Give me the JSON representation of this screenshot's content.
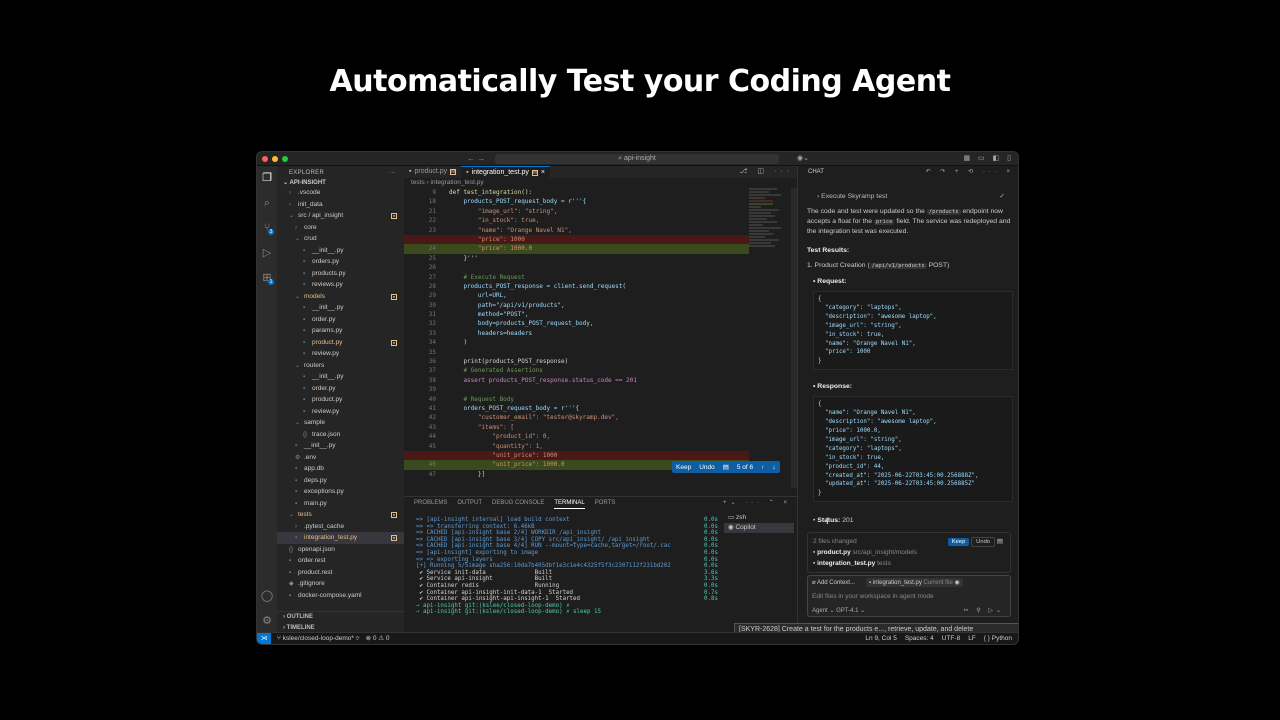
{
  "headline": "Automatically Test your Coding Agent",
  "window": {
    "search": "api-insight",
    "dots": [
      "#ff5f57",
      "#febc2e",
      "#28c840"
    ]
  },
  "explorer": {
    "title": "EXPLORER",
    "root": "API-INSIGHT",
    "items": [
      {
        "label": ".vscode",
        "indent": 12,
        "icon": "›"
      },
      {
        "label": "init_data",
        "indent": 12,
        "icon": "›"
      },
      {
        "label": "src / api_insight",
        "indent": 12,
        "icon": "⌄",
        "mod": true
      },
      {
        "label": "core",
        "indent": 18,
        "icon": "›"
      },
      {
        "label": "crud",
        "indent": 18,
        "icon": "⌄"
      },
      {
        "label": "__init__.py",
        "indent": 26,
        "icon": "▪",
        "py": true
      },
      {
        "label": "orders.py",
        "indent": 26,
        "icon": "▪",
        "py": true
      },
      {
        "label": "products.py",
        "indent": 26,
        "icon": "▪",
        "py": true
      },
      {
        "label": "reviews.py",
        "indent": 26,
        "icon": "▪",
        "py": true
      },
      {
        "label": "models",
        "indent": 18,
        "icon": "⌄",
        "mod": true,
        "y": true
      },
      {
        "label": "__init__.py",
        "indent": 26,
        "icon": "▪",
        "py": true
      },
      {
        "label": "order.py",
        "indent": 26,
        "icon": "▪",
        "py": true
      },
      {
        "label": "params.py",
        "indent": 26,
        "icon": "▪",
        "py": true
      },
      {
        "label": "product.py",
        "indent": 26,
        "icon": "▪",
        "py": true,
        "mod": true,
        "y": true
      },
      {
        "label": "review.py",
        "indent": 26,
        "icon": "▪",
        "py": true
      },
      {
        "label": "routers",
        "indent": 18,
        "icon": "⌄"
      },
      {
        "label": "__init__.py",
        "indent": 26,
        "icon": "▪",
        "py": true
      },
      {
        "label": "order.py",
        "indent": 26,
        "icon": "▪",
        "py": true
      },
      {
        "label": "product.py",
        "indent": 26,
        "icon": "▪",
        "py": true
      },
      {
        "label": "review.py",
        "indent": 26,
        "icon": "▪",
        "py": true
      },
      {
        "label": "sample",
        "indent": 18,
        "icon": "⌄"
      },
      {
        "label": "trace.json",
        "indent": 26,
        "icon": "{}"
      },
      {
        "label": "__init__.py",
        "indent": 18,
        "icon": "▪",
        "py": true
      },
      {
        "label": ".env",
        "indent": 18,
        "icon": "⚙"
      },
      {
        "label": "app.db",
        "indent": 18,
        "icon": "▪"
      },
      {
        "label": "deps.py",
        "indent": 18,
        "icon": "▪",
        "py": true
      },
      {
        "label": "exceptions.py",
        "indent": 18,
        "icon": "▪",
        "py": true
      },
      {
        "label": "main.py",
        "indent": 18,
        "icon": "▪",
        "py": true
      },
      {
        "label": "tests",
        "indent": 12,
        "icon": "⌄",
        "mod": true,
        "y": true
      },
      {
        "label": ".pytest_cache",
        "indent": 18,
        "icon": "›"
      },
      {
        "label": "integration_test.py",
        "indent": 18,
        "icon": "▪",
        "py": true,
        "mod": true,
        "sel": true,
        "y": true
      },
      {
        "label": "openapi.json",
        "indent": 12,
        "icon": "{}"
      },
      {
        "label": "order.rest",
        "indent": 12,
        "icon": "▪"
      },
      {
        "label": "product.rest",
        "indent": 12,
        "icon": "▪"
      },
      {
        "label": ".gitignore",
        "indent": 12,
        "icon": "◆"
      },
      {
        "label": "docker-compose.yaml",
        "indent": 12,
        "icon": "▪"
      }
    ],
    "outline": "OUTLINE",
    "timeline": "TIMELINE"
  },
  "editor": {
    "tabs": [
      {
        "label": "product.py",
        "active": false
      },
      {
        "label": "integration_test.py",
        "active": true
      }
    ],
    "breadcrumb": "tests  ›  integration_test.py",
    "keepbar": {
      "keep": "Keep",
      "undo": "Undo",
      "count": "5 of 6"
    },
    "lines": [
      {
        "n": "9",
        "cls": "",
        "t": "def test_integration():"
      },
      {
        "n": "18",
        "cls": "",
        "t": "    products_POST_request_body = r'''{"
      },
      {
        "n": "21",
        "cls": "",
        "t": "        \"image_url\": \"string\","
      },
      {
        "n": "22",
        "cls": "",
        "t": "        \"in_stock\": true,"
      },
      {
        "n": "23",
        "cls": "",
        "t": "        \"name\": \"Orange Navel N1\","
      },
      {
        "n": "",
        "cls": "del",
        "t": "        \"price\": 1000"
      },
      {
        "n": "24",
        "cls": "add",
        "t": "        \"price\": 1000.0"
      },
      {
        "n": "25",
        "cls": "",
        "t": "    }'''"
      },
      {
        "n": "26",
        "cls": "",
        "t": ""
      },
      {
        "n": "27",
        "cls": "",
        "t": "    # Execute Request"
      },
      {
        "n": "28",
        "cls": "",
        "t": "    products_POST_response = client.send_request("
      },
      {
        "n": "29",
        "cls": "",
        "t": "        url=URL,"
      },
      {
        "n": "30",
        "cls": "",
        "t": "        path=\"/api/v1/products\","
      },
      {
        "n": "31",
        "cls": "",
        "t": "        method=\"POST\","
      },
      {
        "n": "32",
        "cls": "",
        "t": "        body=products_POST_request_body,"
      },
      {
        "n": "33",
        "cls": "",
        "t": "        headers=headers"
      },
      {
        "n": "34",
        "cls": "",
        "t": "    )"
      },
      {
        "n": "35",
        "cls": "",
        "t": ""
      },
      {
        "n": "36",
        "cls": "",
        "t": "    print(products_POST_response)"
      },
      {
        "n": "37",
        "cls": "",
        "t": "    # Generated Assertions"
      },
      {
        "n": "38",
        "cls": "",
        "t": "    assert products_POST_response.status_code == 201"
      },
      {
        "n": "39",
        "cls": "",
        "t": ""
      },
      {
        "n": "40",
        "cls": "",
        "t": "    # Request Body"
      },
      {
        "n": "41",
        "cls": "",
        "t": "    orders_POST_request_body = r'''{"
      },
      {
        "n": "42",
        "cls": "",
        "t": "        \"customer_email\": \"tester@skyramp.dev\","
      },
      {
        "n": "43",
        "cls": "",
        "t": "        \"items\": ["
      },
      {
        "n": "44",
        "cls": "",
        "t": "            \"product_id\": 0,"
      },
      {
        "n": "45",
        "cls": "",
        "t": "            \"quantity\": 1,"
      },
      {
        "n": "",
        "cls": "del",
        "t": "            \"unit_price\": 1000"
      },
      {
        "n": "46",
        "cls": "add",
        "t": "            \"unit_price\": 1000.0"
      },
      {
        "n": "47",
        "cls": "",
        "t": "        }]"
      }
    ]
  },
  "panel": {
    "tabs": [
      "PROBLEMS",
      "OUTPUT",
      "DEBUG CONSOLE",
      "TERMINAL",
      "PORTS"
    ],
    "active": "TERMINAL",
    "terminals": [
      "zsh",
      "Copilot"
    ],
    "lines": [
      {
        "a": "=> [api-insight internal] load build context",
        "b": "0.0s",
        "cls": "a"
      },
      {
        "a": "=> => transferring context: 6.46kB",
        "b": "0.0s",
        "cls": "a"
      },
      {
        "a": "=> CACHED [api-insight base 2/4] WORKDIR /api_insight",
        "b": "0.0s",
        "cls": "a"
      },
      {
        "a": "=> CACHED [api-insight base 3/4] COPY src/api_insight/ /api_insight",
        "b": "0.0s",
        "cls": "a"
      },
      {
        "a": "=> CACHED [api-insight base 4/4] RUN --mount=type=cache,target=/root/.cac",
        "b": "0.0s",
        "cls": "a"
      },
      {
        "a": "=> [api-insight] exporting to image",
        "b": "0.0s",
        "cls": "a"
      },
      {
        "a": "=> => exporting layers",
        "b": "0.0s",
        "cls": "a"
      },
      {
        "a": "[+] Running 5/5image sha256:10da7b405dbf1e3c1e4c4325f5f3c2307112f231bd202",
        "b": "0.0s",
        "cls": "a"
      },
      {
        "a": " ✔ Service init-data              Built",
        "b": "3.6s",
        "cls": "ok"
      },
      {
        "a": " ✔ Service api-insight            Built",
        "b": "3.3s",
        "cls": "ok"
      },
      {
        "a": " ✔ Container redis                Running",
        "b": "0.0s",
        "cls": "ok"
      },
      {
        "a": " ✔ Container api-insight-init-data-1  Started",
        "b": "0.7s",
        "cls": "ok"
      },
      {
        "a": " ✔ Container api-insight-api-insight-1  Started",
        "b": "0.8s",
        "cls": "ok"
      },
      {
        "a": "→ api-insight git:(kslee/closed-loop-demo) ✗",
        "b": "",
        "cls": "p"
      },
      {
        "a": "→ api-insight git:(kslee/closed-loop-demo) ✗ sleep 15",
        "b": "",
        "cls": "p"
      }
    ]
  },
  "chat": {
    "title": "CHAT",
    "step": "Execute Skyramp test",
    "para1a": "The code and test were updated so the ",
    "para1chip": "/products",
    "para1b": " endpoint now accepts a float for the ",
    "para1chip2": "price",
    "para1c": " field. The service was redeployed and the integration test was executed.",
    "results": "Test Results:",
    "item1a": "1. Product Creation (",
    "item1chip": "/api/v1/products",
    "item1b": " POST)",
    "request_label": "Request:",
    "request_lines": [
      "{",
      "  \"category\": \"laptops\",",
      "  \"description\": \"awesome laptop\",",
      "  \"image_url\": \"string\",",
      "  \"in_stock\": true,",
      "  \"name\": \"Orange Navel N1\",",
      "  \"price\": 1000",
      "}"
    ],
    "response_label": "Response:",
    "response_lines": [
      "{",
      "  \"name\": \"Orange Navel N1\",",
      "  \"description\": \"awesome laptop\",",
      "  \"price\": 1000.0,",
      "  \"image_url\": \"string\",",
      "  \"category\": \"laptops\",",
      "  \"in_stock\": true,",
      "  \"product_id\": 44,",
      "  \"created_at\": \"2025-06-22T03:45:00.256888Z\",",
      "  \"updated_at\": \"2025-06-22T03:45:00.256885Z\"",
      "}"
    ],
    "status_label": "Status:",
    "status_value": "201",
    "files_changed": "2 files changed",
    "keep": "Keep",
    "undo": "Undo",
    "file1": "product.py",
    "file1path": "src/api_insight/models",
    "file2": "integration_test.py",
    "file2path": "tests",
    "add_context": "Add Context...",
    "ctx_file": "integration_test.py",
    "ctx_file_note": "Current file",
    "placeholder": "Edit files in your workspace in agent mode",
    "agent": "Agent",
    "model": "GPT-4.1"
  },
  "tooltip": "[SKYR-2628] Create a test for the products e..., retrieve, update, and delete",
  "status": {
    "branch": "kslee/closed-loop-demo*",
    "problems": "⊗ 0  ⚠ 0",
    "pos": "Ln 9, Col 5",
    "spaces": "Spaces: 4",
    "enc": "UTF-8",
    "eol": "LF",
    "lang": "Python"
  }
}
